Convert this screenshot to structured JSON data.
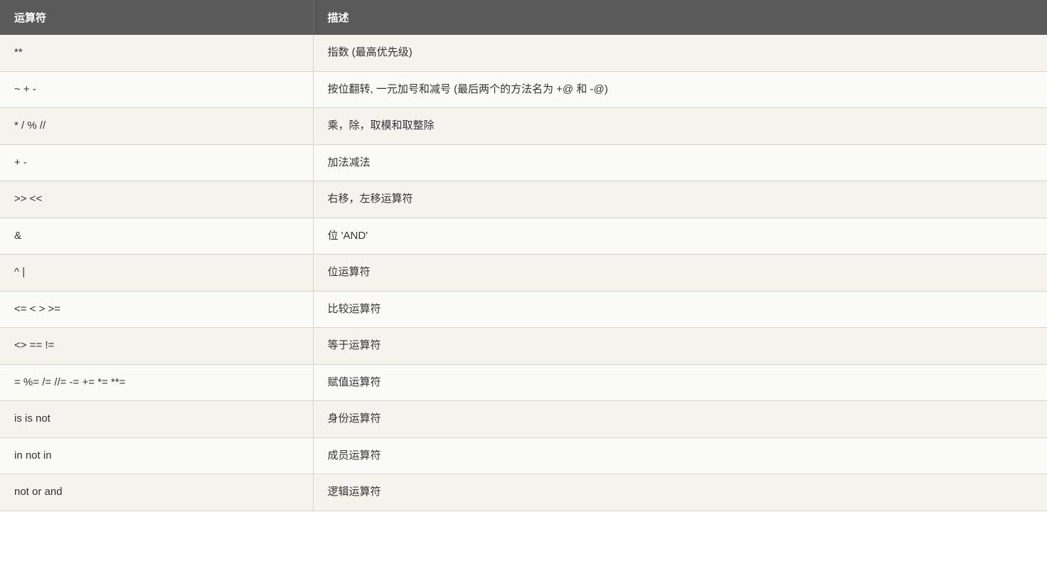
{
  "table": {
    "headers": [
      {
        "id": "operator",
        "label": "运算符"
      },
      {
        "id": "description",
        "label": "描述"
      }
    ],
    "rows": [
      {
        "operator": "**",
        "description": "指数 (最高优先级)"
      },
      {
        "operator": "~ + -",
        "description": "按位翻转, 一元加号和减号 (最后两个的方法名为 +@ 和 -@)"
      },
      {
        "operator": "* / % //",
        "description": "乘，除，取模和取整除"
      },
      {
        "operator": "+ -",
        "description": "加法减法"
      },
      {
        "operator": ">> <<",
        "description": "右移，左移运算符"
      },
      {
        "operator": "&",
        "description": "位 'AND'"
      },
      {
        "operator": "^ |",
        "description": "位运算符"
      },
      {
        "operator": "<= < > >=",
        "description": "比较运算符"
      },
      {
        "operator": "<> == !=",
        "description": "等于运算符"
      },
      {
        "operator": "= %= /= //= -= += *= **=",
        "description": "赋值运算符"
      },
      {
        "operator": "is is not",
        "description": "身份运算符"
      },
      {
        "operator": "in not in",
        "description": "成员运算符"
      },
      {
        "operator": "not or and",
        "description": "逻辑运算符"
      }
    ]
  }
}
